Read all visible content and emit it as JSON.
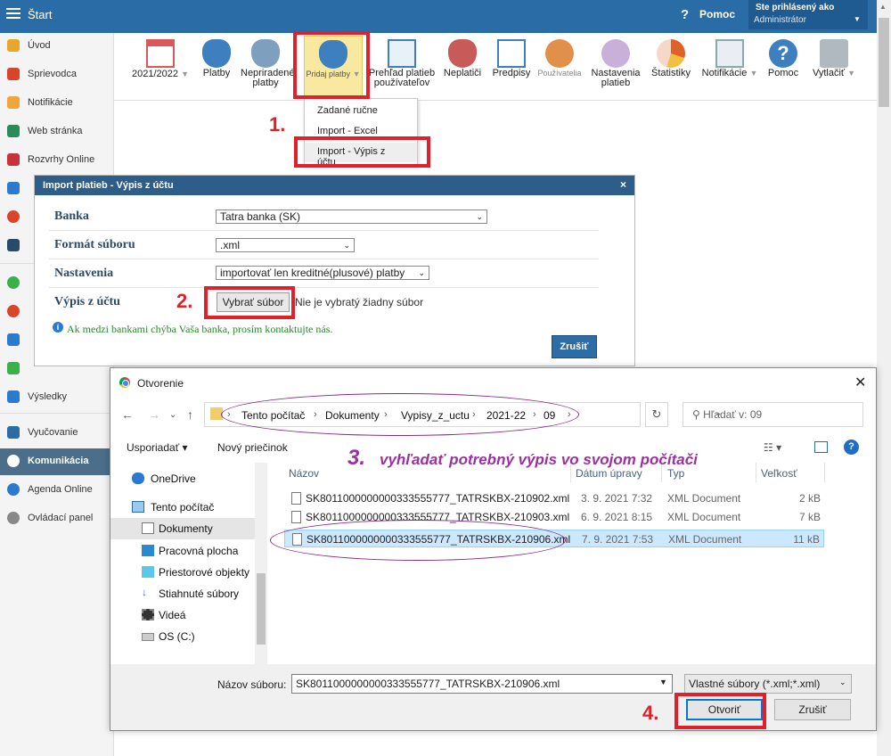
{
  "app": {
    "title": "Štart",
    "help": "Pomoc",
    "user_line1": "Ste prihlásený ako",
    "user_line2": "Administrátor"
  },
  "sidebar": {
    "items": [
      "Úvod",
      "Sprievodca",
      "Notifikácie",
      "Web stránka",
      "Rozvrhy Online",
      "Výsledky",
      "Vyučovanie",
      "Komunikácia",
      "Agenda Online",
      "Ovládací panel"
    ]
  },
  "ribbon": {
    "items": [
      "2021/2022",
      "Platby",
      "Nepriradené platby",
      "Pridaj platby",
      "Prehľad platieb používateľov",
      "Neplatiči",
      "Predpisy",
      "Používatelia",
      "Nastavenia platieb",
      "Štatistiky",
      "Notifikácie",
      "Pomoc",
      "Vytlačiť"
    ]
  },
  "dropdown": {
    "items": [
      "Zadané ručne",
      "Import - Excel",
      "Import - Výpis z účtu"
    ]
  },
  "import_dialog": {
    "title": "Import platieb - Výpis z účtu",
    "close": "×",
    "labels": {
      "bank": "Banka",
      "format": "Formát súboru",
      "settings": "Nastavenia",
      "statement": "Výpis z účtu"
    },
    "bank_value": "Tatra banka (SK)",
    "format_value": ".xml",
    "settings_value": "importovať len kreditné(plusové) platby",
    "choose_button": "Vybrať súbor",
    "no_file": "Nie je vybratý žiadny súbor",
    "info": "Ak medzi bankami chýba Vaša banka, prosím kontaktujte nás.",
    "cancel": "Zrušiť"
  },
  "file_dialog": {
    "title": "Otvorenie",
    "close": "✕",
    "breadcrumb": [
      "Tento počítač",
      "Dokumenty",
      "Vypisy_z_uctu",
      "2021-22",
      "09"
    ],
    "search_placeholder": "Hľadať v: 09",
    "organize": "Usporiadať ▾",
    "new_folder": "Nový priečinok",
    "nav": [
      "OneDrive",
      "Tento počítač",
      "Dokumenty",
      "Pracovná plocha",
      "Priestorové objekty",
      "Stiahnuté súbory",
      "Videá",
      "OS (C:)"
    ],
    "columns": [
      "Názov",
      "Dátum úpravy",
      "Typ",
      "Veľkosť"
    ],
    "files": [
      {
        "name": "SK8011000000000333555777_TATRSKBX-210902.xml",
        "date": "3. 9. 2021  7:32",
        "type": "XML Document",
        "size": "2 kB"
      },
      {
        "name": "SK8011000000000333555777_TATRSKBX-210903.xml",
        "date": "6. 9. 2021  8:15",
        "type": "XML Document",
        "size": "7 kB"
      },
      {
        "name": "SK8011000000000333555777_TATRSKBX-210906.xml",
        "date": "7. 9. 2021  7:53",
        "type": "XML Document",
        "size": "11 kB"
      }
    ],
    "filename_label": "Názov súboru:",
    "filename_value": "SK8011000000000333555777_TATRSKBX-210906.xml",
    "filetype": "Vlastné súbory (*.xml;*.xml)",
    "open": "Otvoriť",
    "cancel": "Zrušiť"
  },
  "annotations": {
    "step1": "1.",
    "step2": "2.",
    "step3": "3.",
    "step3_text": "vyhľadať potrebný výpis vo svojom počítači",
    "step4": "4."
  },
  "colors": {
    "topbar": "#2a6ca6",
    "annotation_red": "#e0202a",
    "annotation_purple": "#9b30a0",
    "selection": "#cce8ff"
  }
}
